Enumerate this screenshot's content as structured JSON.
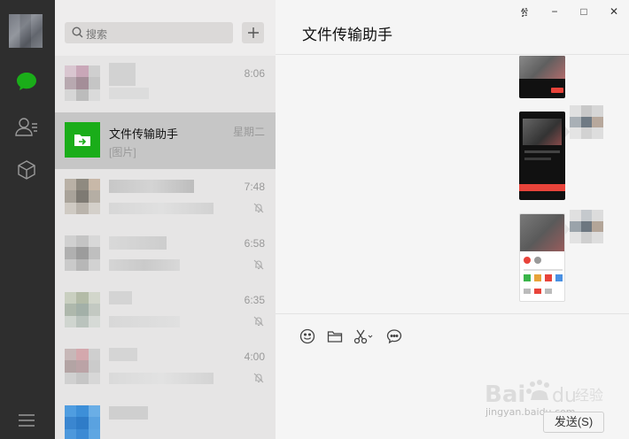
{
  "search": {
    "placeholder": "搜索"
  },
  "chat_list": [
    {
      "time": "8:06",
      "blurred": true
    },
    {
      "name": "文件传输助手",
      "preview": "[图片]",
      "time": "星期二",
      "active": true
    },
    {
      "time": "7:48",
      "muted": true,
      "blurred": true
    },
    {
      "time": "6:58",
      "muted": true,
      "blurred": true
    },
    {
      "time": "6:35",
      "muted": true,
      "blurred": true
    },
    {
      "time": "4:00",
      "muted": true,
      "blurred": true
    },
    {
      "blurred": true
    }
  ],
  "chat": {
    "title": "文件传输助手"
  },
  "window": {
    "pin": "፳",
    "minimize": "−",
    "maximize": "□",
    "close": "✕"
  },
  "composer": {
    "send_label": "发送(S)"
  },
  "watermark": {
    "text": "jingyan.baidu.com",
    "logo": "Baidu 经验"
  },
  "icons": {
    "chat": "chat-bubble-icon",
    "contacts": "contacts-icon",
    "favorites": "cube-icon",
    "menu": "hamburger-icon",
    "search": "search-icon",
    "add": "plus-icon",
    "emoji": "emoji-icon",
    "folder": "folder-icon",
    "scissors": "scissors-icon",
    "bubble": "chat-history-icon"
  },
  "colors": {
    "sidebar": "#2e2e2e",
    "accent": "#1aad19",
    "list_bg": "#e6e5e5",
    "active_row": "#c6c6c6"
  }
}
